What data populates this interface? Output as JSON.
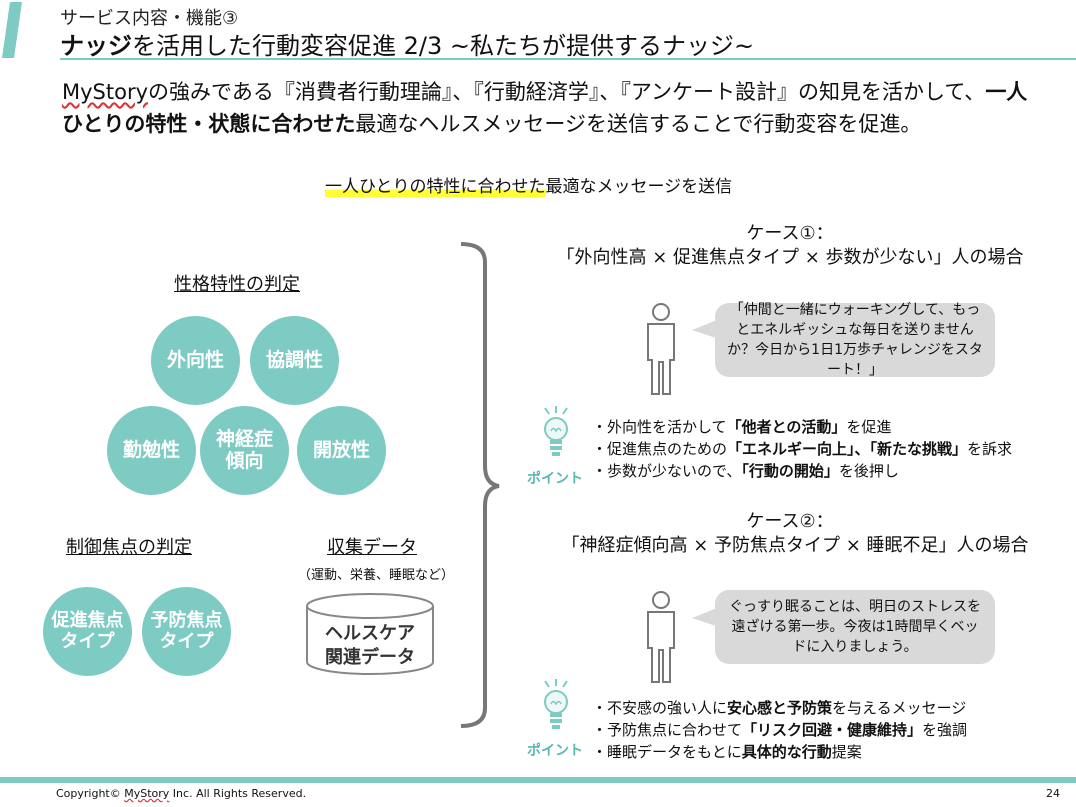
{
  "header": {
    "subtitle": "サービス内容・機能③",
    "title_bold": "ナッジ",
    "title_rest": "を活用した行動変容促進 2/3 ~私たちが提供するナッジ~"
  },
  "intro": {
    "brand": "MyStory",
    "part1": "の強みである『消費者行動理論』、『行動経済学』、『アンケート設計』の知見を活かして、",
    "bold": "一人ひとりの特性・状態に合わせた",
    "part2": "最適なヘルスメッセージを送信することで行動変容を促進。"
  },
  "highlight": {
    "marked": "一人ひとりの特性に合わせた",
    "rest": "最適なメッセージを送信"
  },
  "personality": {
    "label": "性格特性の判定",
    "traits": [
      "外向性",
      "協調性",
      "勤勉性",
      "神経症傾向",
      "開放性"
    ]
  },
  "control": {
    "label": "制御焦点の判定",
    "types": [
      "促進焦点タイプ",
      "予防焦点タイプ"
    ]
  },
  "collected": {
    "label": "収集データ",
    "note": "（運動、栄養、睡眠など）",
    "db_line1": "ヘルスケア",
    "db_line2": "関連データ"
  },
  "cases": [
    {
      "title": "ケース①：",
      "subtitle": "「外向性高 × 促進焦点タイプ × 歩数が少ない」人の場合",
      "message": "「仲間と一緒にウォーキングして、もっとエネルギッシュな毎日を送りませんか？今日から1日1万歩チャレンジをスタート！」",
      "point_label": "ポイント",
      "points": [
        {
          "pre": "・外向性を活かして",
          "bold": "「他者との活動」",
          "post": "を促進"
        },
        {
          "pre": "・促進焦点のための",
          "bold": "「エネルギー向上」、「新たな挑戦」",
          "post": "を訴求"
        },
        {
          "pre": "・歩数が少ないので、",
          "bold": "「行動の開始」",
          "post": "を後押し"
        }
      ]
    },
    {
      "title": "ケース②：",
      "subtitle": "「神経症傾向高 × 予防焦点タイプ × 睡眠不足」人の場合",
      "message": "ぐっすり眠ることは、明日のストレスを遠ざける第一歩。今夜は1時間早くベッドに入りましょう。",
      "point_label": "ポイント",
      "points": [
        {
          "pre": "・不安感の強い人に",
          "bold": "安心感と予防策",
          "post": "を与えるメッセージ"
        },
        {
          "pre": "・予防焦点に合わせて",
          "bold": "「リスク回避・健康維持」",
          "post": "を強調"
        },
        {
          "pre": "・睡眠データをもとに",
          "bold": "具体的な行動",
          "post": "提案"
        }
      ]
    }
  ],
  "footer": {
    "copy_pre": "Copyright© ",
    "copy_brand": "MyStory",
    "copy_post": " Inc. All Rights Reserved.",
    "page": "24"
  },
  "colors": {
    "accent": "#7ecbc4",
    "point": "#59b9b0",
    "highlight": "#ffff33",
    "bubble": "#d9d9d9"
  }
}
